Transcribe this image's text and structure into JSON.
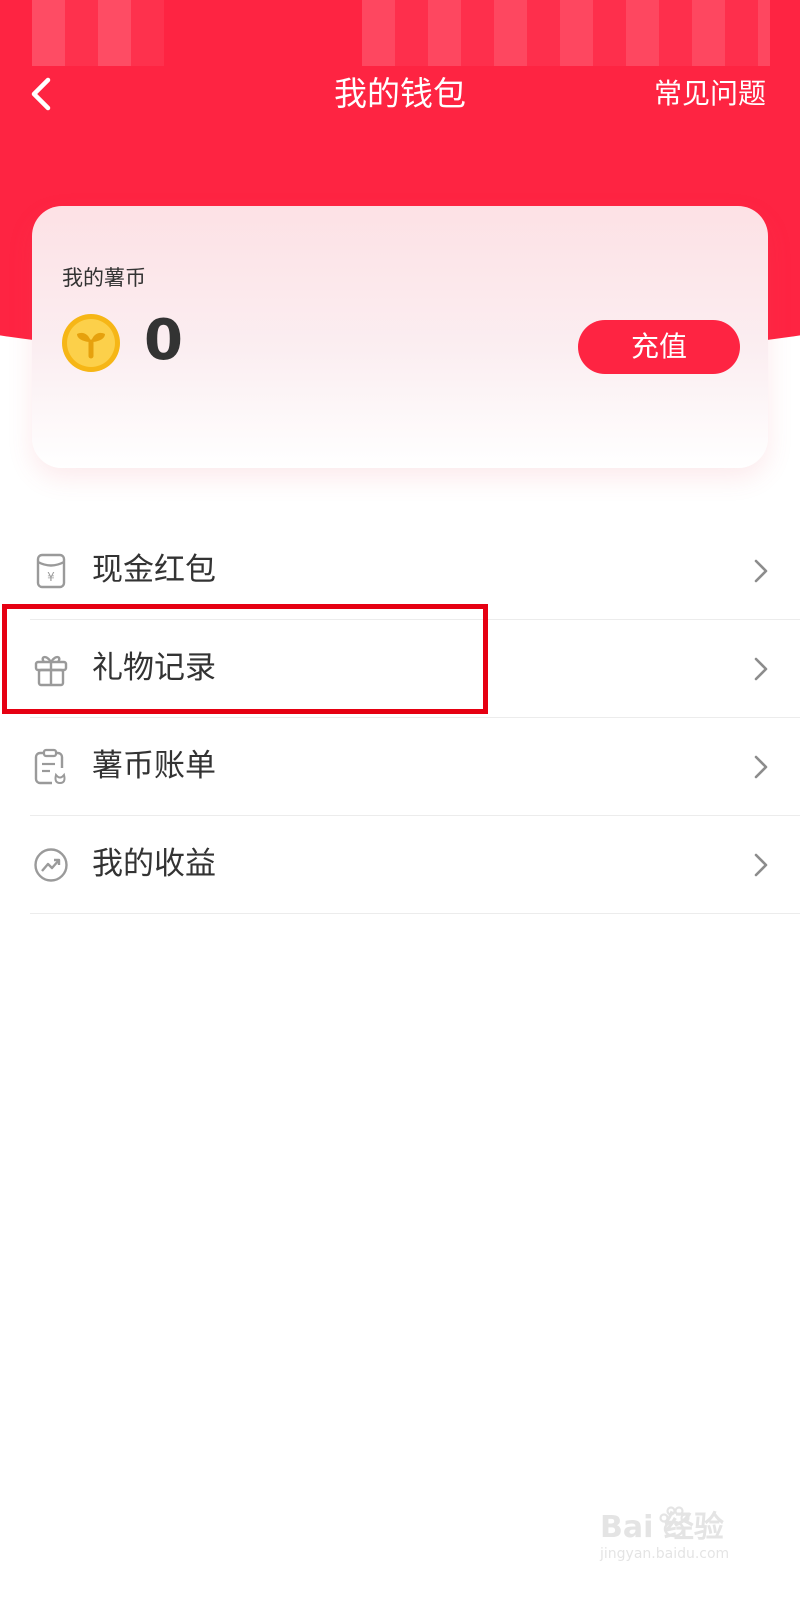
{
  "header": {
    "title": "我的钱包",
    "faq_label": "常见问题",
    "background_color": "#fe2442"
  },
  "wallet_card": {
    "label": "我的薯币",
    "balance": "0",
    "recharge_label": "充值",
    "coin_icon": "coin-sprout-icon"
  },
  "menu": {
    "items": [
      {
        "label": "现金红包",
        "icon": "red-envelope-icon"
      },
      {
        "label": "礼物记录",
        "icon": "gift-icon"
      },
      {
        "label": "薯币账单",
        "icon": "bill-icon"
      },
      {
        "label": "我的收益",
        "icon": "earnings-trend-icon"
      }
    ]
  },
  "highlight": {
    "color": "#e60012"
  },
  "watermark": {
    "text": "Bai 经验",
    "subtext": "jingyan.baidu.com"
  }
}
